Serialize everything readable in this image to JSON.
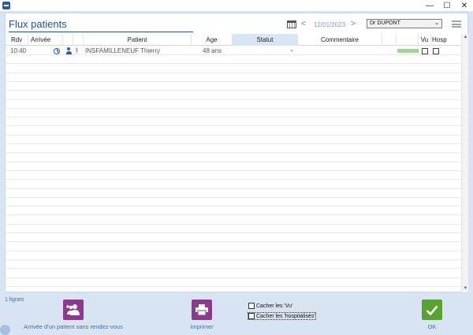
{
  "window": {
    "minimize_glyph": "—",
    "maximize_glyph": "☐",
    "close_glyph": "✕"
  },
  "header": {
    "title": "Flux patients",
    "date": "12/01/2023",
    "prev_glyph": "<",
    "next_glyph": ">",
    "doctor": "Dr DUPONT"
  },
  "columns": {
    "rdv": "Rdv",
    "arrivee": "Arrivée",
    "patient": "Patient",
    "age": "Age",
    "statut": "Statut",
    "commentaire": "Commentaire",
    "vu": "Vu",
    "hosp": "Hosp"
  },
  "rows": [
    {
      "rdv": "10:40",
      "patient": "INSFAMILLENEUF Thierry",
      "age": "48 ans",
      "statut": "",
      "commentaire": "",
      "status_color": "#a3d39c",
      "vu": false,
      "hosp": false
    }
  ],
  "footer": {
    "row_count": "1 lignes",
    "walkin_label": "Arrivée d'un patient sans rendez-vous",
    "print_label": "Imprimer",
    "hide_seen_label": "Cacher les 'Vu'",
    "hide_hosp_label": "Cacher les 'hospitalisés'",
    "ok_label": "OK"
  },
  "colors": {
    "accent": "#2b4e8c",
    "walkin_tile": "#8b3a8f",
    "print_tile": "#8b3a8f",
    "ok_tile": "#58a232",
    "statut_header": "#d6e6f5"
  }
}
